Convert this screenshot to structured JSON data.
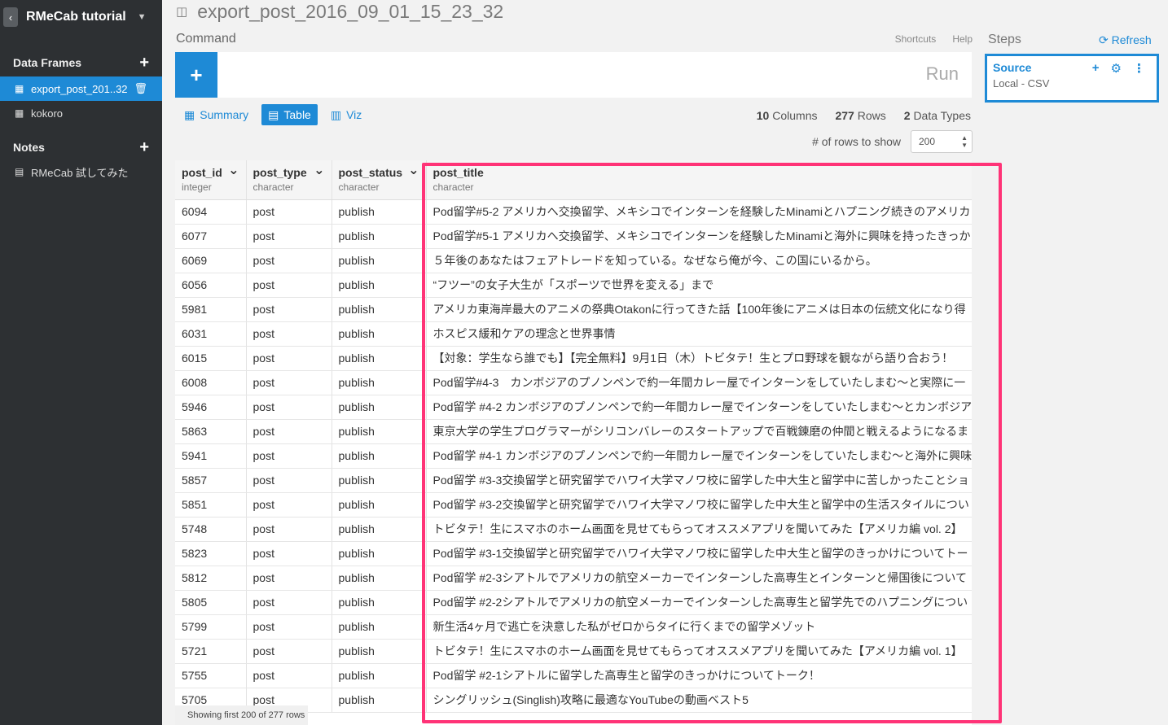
{
  "project": {
    "name": "RMeCab tutorial",
    "back_icon": "chevron-left-icon"
  },
  "sidebar": {
    "data_frames_title": "Data Frames",
    "frames": [
      {
        "label": "export_post_201..32",
        "active": true
      },
      {
        "label": "kokoro",
        "active": false
      }
    ],
    "notes_title": "Notes",
    "notes": [
      {
        "label": "RMeCab 試してみた"
      }
    ]
  },
  "header": {
    "title": "export_post_2016_09_01_15_23_32"
  },
  "command": {
    "label": "Command",
    "shortcuts": "Shortcuts",
    "help": "Help",
    "run": "Run"
  },
  "views": {
    "summary": "Summary",
    "table": "Table",
    "viz": "Viz"
  },
  "stats": {
    "columns_n": "10",
    "columns_label": "Columns",
    "rows_n": "277",
    "rows_label": "Rows",
    "types_n": "2",
    "types_label": "Data Types"
  },
  "rows_to_show": {
    "label": "# of rows to show",
    "value": "200"
  },
  "table": {
    "columns": [
      {
        "name": "post_id",
        "type": "integer"
      },
      {
        "name": "post_type",
        "type": "character"
      },
      {
        "name": "post_status",
        "type": "character"
      },
      {
        "name": "post_title",
        "type": "character"
      }
    ],
    "rows": [
      [
        "6094",
        "post",
        "publish",
        "Pod留学#5-2 アメリカへ交換留学、メキシコでインターンを経験したMinamiとハプニング続きのアメリカ"
      ],
      [
        "6077",
        "post",
        "publish",
        "Pod留学#5-1 アメリカへ交換留学、メキシコでインターンを経験したMinamiと海外に興味を持ったきっか"
      ],
      [
        "6069",
        "post",
        "publish",
        "５年後のあなたはフェアトレードを知っている。なぜなら俺が今、この国にいるから。"
      ],
      [
        "6056",
        "post",
        "publish",
        "“フツー”の女子大生が「スポーツで世界を変える」まで"
      ],
      [
        "5981",
        "post",
        "publish",
        "アメリカ東海岸最大のアニメの祭典Otakonに行ってきた話【100年後にアニメは日本の伝統文化になり得"
      ],
      [
        "6031",
        "post",
        "publish",
        "ホスピス緩和ケアの理念と世界事情"
      ],
      [
        "6015",
        "post",
        "publish",
        "【対象：学生なら誰でも】【完全無料】9月1日（木）トビタテ！生とプロ野球を観ながら語り合おう！"
      ],
      [
        "6008",
        "post",
        "publish",
        "Pod留学#4-3　カンボジアのプノンペンで約一年間カレー屋でインターンをしていたしまむ〜と実際に一"
      ],
      [
        "5946",
        "post",
        "publish",
        "Pod留学 #4-2 カンボジアのプノンペンで約一年間カレー屋でインターンをしていたしまむ〜とカンボジア"
      ],
      [
        "5863",
        "post",
        "publish",
        "東京大学の学生プログラマーがシリコンバレーのスタートアップで百戦錬磨の仲間と戦えるようになるま"
      ],
      [
        "5941",
        "post",
        "publish",
        "Pod留学 #4-1 カンボジアのプノンペンで約一年間カレー屋でインターンをしていたしまむ〜と海外に興味"
      ],
      [
        "5857",
        "post",
        "publish",
        "Pod留学 #3-3交換留学と研究留学でハワイ大学マノワ校に留学した中大生と留学中に苦しかったことショ"
      ],
      [
        "5851",
        "post",
        "publish",
        "Pod留学 #3-2交換留学と研究留学でハワイ大学マノワ校に留学した中大生と留学中の生活スタイルについ"
      ],
      [
        "5748",
        "post",
        "publish",
        "トビタテ！生にスマホのホーム画面を見せてもらってオススメアプリを聞いてみた【アメリカ編 vol. 2】"
      ],
      [
        "5823",
        "post",
        "publish",
        "Pod留学 #3-1交換留学と研究留学でハワイ大学マノワ校に留学した中大生と留学のきっかけについてトー"
      ],
      [
        "5812",
        "post",
        "publish",
        "Pod留学 #2-3シアトルでアメリカの航空メーカーでインターンした高専生とインターンと帰国後について"
      ],
      [
        "5805",
        "post",
        "publish",
        "Pod留学 #2-2シアトルでアメリカの航空メーカーでインターンした高専生と留学先でのハプニングについ"
      ],
      [
        "5799",
        "post",
        "publish",
        "新生活4ヶ月で逃亡を決意した私がゼロからタイに行くまでの留学メゾット"
      ],
      [
        "5721",
        "post",
        "publish",
        "トビタテ！生にスマホのホーム画面を見せてもらってオススメアプリを聞いてみた【アメリカ編 vol. 1】"
      ],
      [
        "5755",
        "post",
        "publish",
        "Pod留学 #2-1シアトルに留学した高専生と留学のきっかけについてトーク！"
      ],
      [
        "5705",
        "post",
        "publish",
        "シングリッシュ(Singlish)攻略に最適なYouTubeの動画ベスト5"
      ]
    ],
    "footer": "Showing first 200 of 277 rows"
  },
  "steps": {
    "title": "Steps",
    "refresh": "Refresh",
    "source_name": "Source",
    "source_sub": "Local - CSV"
  },
  "colors": {
    "accent": "#1e8ad6",
    "highlight": "#ff3377",
    "sidebar": "#2d3033"
  }
}
